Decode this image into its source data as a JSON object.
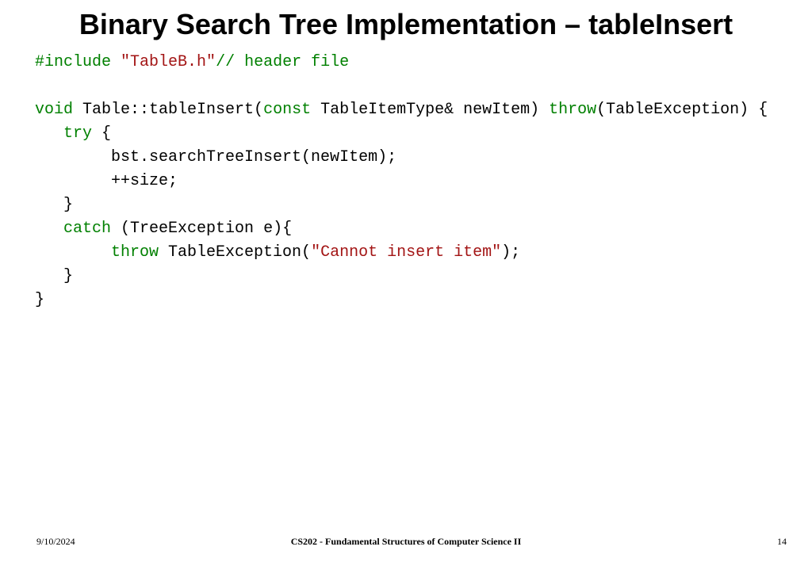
{
  "title": "Binary Search Tree Implementation – tableInsert",
  "code": {
    "l1_include": "#include",
    "l1_str": "\"TableB.h\"",
    "l1_cmt": "// header file",
    "l3_kw_void": "void",
    "l3_rest1": " Table::tableInsert(",
    "l3_kw_const": "const",
    "l3_rest2": " TableItemType& newItem) ",
    "l3_kw_throw": "throw",
    "l3_rest3": "(TableException) {",
    "l4_indent": "   ",
    "l4_kw_try": "try",
    "l4_rest": " {",
    "l5": "        bst.searchTreeInsert(newItem);",
    "l6": "        ++size;",
    "l7": "   }",
    "l8_indent": "   ",
    "l8_kw_catch": "catch",
    "l8_rest": " (TreeException e){",
    "l9_indent": "        ",
    "l9_kw_throw": "throw",
    "l9_mid": " TableException(",
    "l9_str": "\"Cannot insert item\"",
    "l9_end": ");",
    "l10": "   }",
    "l11": "}"
  },
  "footer": {
    "date": "9/10/2024",
    "course": "CS202 - Fundamental Structures of Computer Science II",
    "page": "14"
  }
}
